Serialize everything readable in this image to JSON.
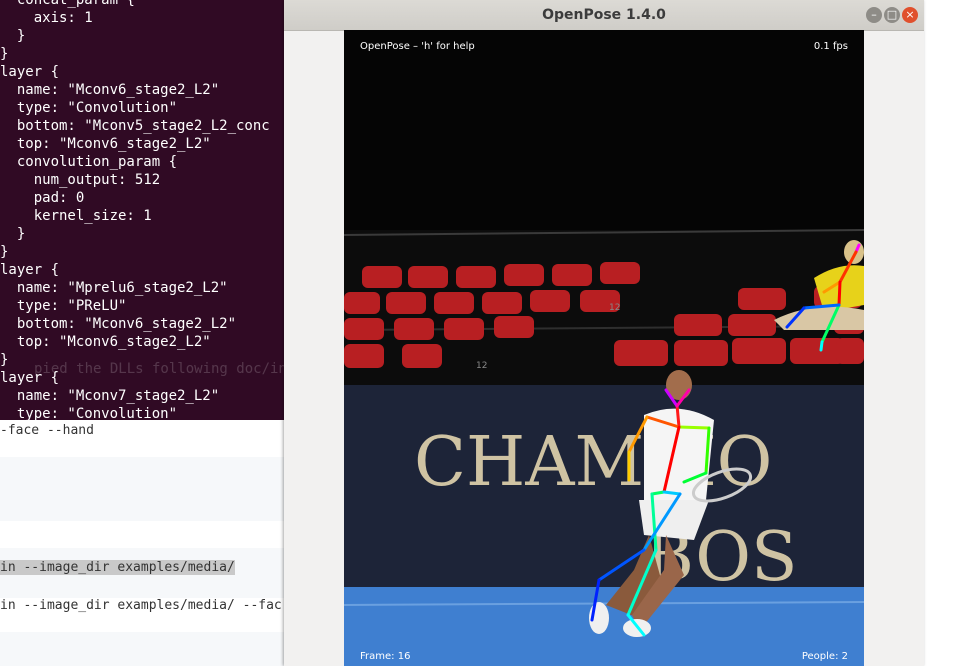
{
  "terminal": {
    "lines": [
      "  concat_param {",
      "    axis: 1",
      "  }",
      "}",
      "layer {",
      "  name: \"Mconv6_stage2_L2\"",
      "  type: \"Convolution\"",
      "  bottom: \"Mconv5_stage2_L2_conc",
      "  top: \"Mconv6_stage2_L2\"",
      "  convolution_param {",
      "    num_output: 512",
      "    pad: 0",
      "    kernel_size: 1",
      "  }",
      "}",
      "layer {",
      "  name: \"Mprelu6_stage2_L2\"",
      "  type: \"PReLU\"",
      "  bottom: \"Mconv6_stage2_L2\"",
      "  top: \"Mconv6_stage2_L2\"",
      "}",
      "layer {",
      "  name: \"Mconv7_stage2_L2\"",
      "  type: \"Convolution\""
    ],
    "ghost_text": "pied the DLLs following doc/insta"
  },
  "docs": {
    "line1": "-face --hand",
    "line2": "in --image_dir examples/media/",
    "line3": "in --image_dir examples/media/ --fac"
  },
  "window": {
    "title": "OpenPose 1.4.0",
    "minimize_glyph": "–",
    "maximize_glyph": "□",
    "close_glyph": "×"
  },
  "overlay": {
    "help": "OpenPose – 'h' for help",
    "fps": "0.1 fps",
    "frame": "Frame: 16",
    "people": "People: 2"
  },
  "scene": {
    "banner_text_1": "CHAMPIO",
    "banner_text_2": "BOS",
    "seat_number_1": "12",
    "seat_number_2": "12"
  },
  "colors": {
    "terminal_bg": "#300a24",
    "court": "#3f7fd0",
    "banner": "#1d2438",
    "seat": "#b81f22"
  }
}
